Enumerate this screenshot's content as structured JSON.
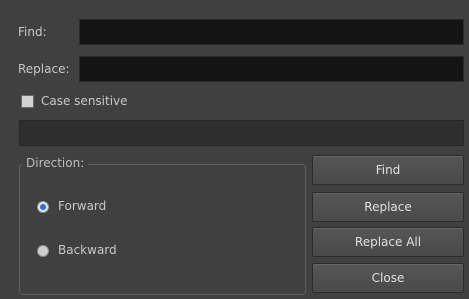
{
  "dialog": {
    "find_label": "Find:",
    "find_value": "",
    "replace_label": "Replace:",
    "replace_value": "",
    "case_sensitive_label": "Case sensitive",
    "case_sensitive_checked": false,
    "status_text": "",
    "direction": {
      "title": "Direction:",
      "options": [
        {
          "label": "Forward",
          "selected": true
        },
        {
          "label": "Backward",
          "selected": false
        }
      ]
    },
    "buttons": {
      "find": "Find",
      "replace": "Replace",
      "replace_all": "Replace All",
      "close": "Close"
    }
  },
  "colors": {
    "background": "#404040",
    "field": "#141414",
    "radio_selected": "#2f6fd0"
  }
}
